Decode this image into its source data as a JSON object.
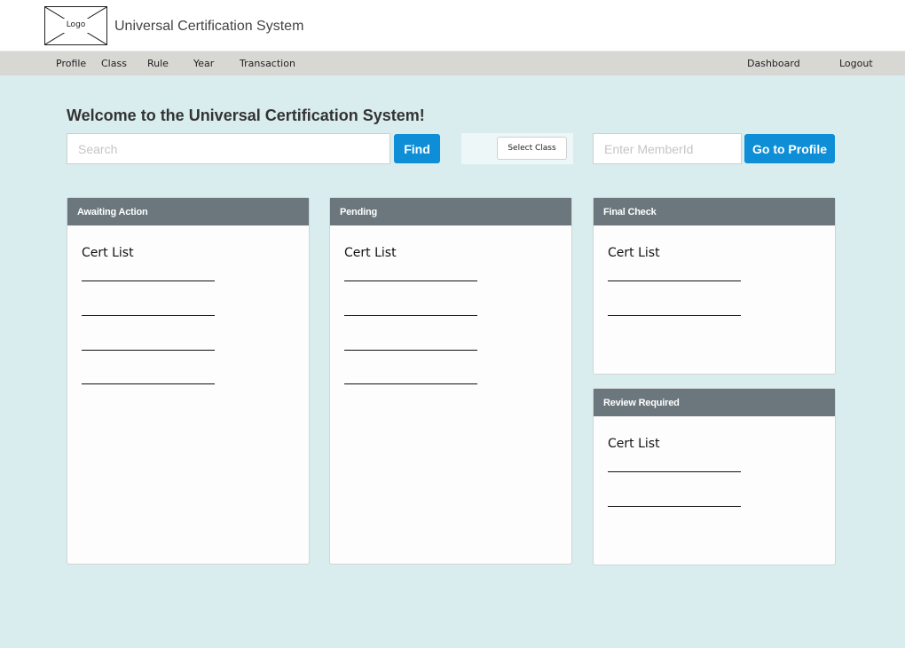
{
  "header": {
    "logo_text": "Logo",
    "app_title": "Universal Certification System"
  },
  "nav": {
    "left": [
      "Profile",
      "Class",
      "Rule",
      "Year",
      "Transaction"
    ],
    "right": [
      "Dashboard",
      "Logout"
    ]
  },
  "main": {
    "welcome": "Welcome to the Universal Certification System!",
    "search": {
      "placeholder": "Search",
      "button": "Find"
    },
    "select_class": "Select Class",
    "member": {
      "placeholder": "Enter MemberId",
      "button": "Go to Profile"
    }
  },
  "panels": [
    {
      "title": "Awaiting Action",
      "list_label": "Cert List",
      "line_count": 4
    },
    {
      "title": "Pending",
      "list_label": "Cert List",
      "line_count": 4
    },
    {
      "title": "Final Check",
      "list_label": "Cert List",
      "line_count": 2
    },
    {
      "title": "Review Required",
      "list_label": "Cert List",
      "line_count": 2
    }
  ],
  "colors": {
    "accent": "#0d8ed6",
    "panel_header": "#6b777c",
    "background": "#d9edee",
    "nav_bar": "#d7d8d3"
  }
}
